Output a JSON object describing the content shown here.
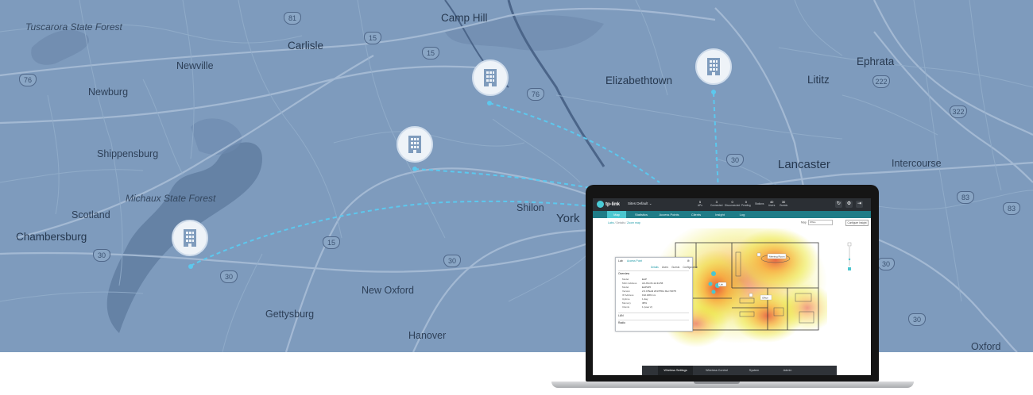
{
  "map": {
    "labels": [
      "Tuscarora State Forest",
      "Camp Hill",
      "Carlisle",
      "Newville",
      "Newburg",
      "Elizabethtown",
      "Lititz",
      "Ephrata",
      "Shippensburg",
      "Michaux State Forest",
      "Scotland",
      "Chambersburg",
      "Shilon",
      "York",
      "Lancaster",
      "Intercourse",
      "New Oxford",
      "Gettysburg",
      "Hanover",
      "Oxford"
    ],
    "shields": [
      "76",
      "15",
      "15",
      "81",
      "76",
      "322",
      "222",
      "83",
      "30",
      "30",
      "15",
      "30",
      "30",
      "30",
      "30",
      "83"
    ]
  },
  "app": {
    "brand": "tp-link",
    "site": "Sites Default",
    "stats": [
      {
        "value": "5",
        "label": "APs"
      },
      {
        "value": "3",
        "label": "Connected"
      },
      {
        "value": "0",
        "label": "Disconnected"
      },
      {
        "value": "0",
        "label": "Pending"
      },
      {
        "value": "40",
        "label": "Users"
      },
      {
        "value": "30",
        "label": "Guests"
      }
    ],
    "stations_label": "Stations",
    "tabs": [
      "Map",
      "Statistics",
      "Access Points",
      "Clients",
      "Insight",
      "Log"
    ],
    "active_tab": "Map",
    "breadcrumb": [
      "Labs",
      "Details",
      "Zoom map"
    ],
    "map_label": "Map",
    "map_value": "Office",
    "configure_label": "Configure Insight",
    "panel": {
      "title": "Lab",
      "subtitle": "Access Point",
      "tabs": [
        "Details",
        "Users",
        "Guests",
        "Configuration"
      ],
      "sections": [
        "Overview",
        "LAN",
        "Radio"
      ],
      "rows": [
        {
          "k": "Model",
          "v": "EAP"
        },
        {
          "k": "MAC Address",
          "v": "AC-84-C6-12-34-56"
        },
        {
          "k": "Model",
          "v": "EAP225"
        },
        {
          "k": "Version",
          "v": "2.0.0 Build 20170511 Rel.72078"
        },
        {
          "k": "IP Address",
          "v": "192.168.0.xx"
        },
        {
          "k": "Uptime",
          "v": "1 day"
        },
        {
          "k": "Memory",
          "v": "38%"
        },
        {
          "k": "Clients",
          "v": "1 (user 2)"
        }
      ]
    },
    "floor_labels": [
      "Meeting Room",
      "Office",
      "Lab"
    ],
    "bottom_tabs": [
      "Wireless Settings",
      "Wireless Control",
      "System",
      "Admin"
    ],
    "active_bottom_tab": "Wireless Settings"
  },
  "colors": {
    "map_bg": "#7e9bbd",
    "road": "#b2c6dc",
    "route": "#5cc8ee",
    "pin_bg": "#eef3f8",
    "teal": "#1f7c87",
    "accent": "#4bc6cf"
  },
  "icons": [
    "building-icon",
    "refresh-icon",
    "settings-icon",
    "logout-icon"
  ]
}
